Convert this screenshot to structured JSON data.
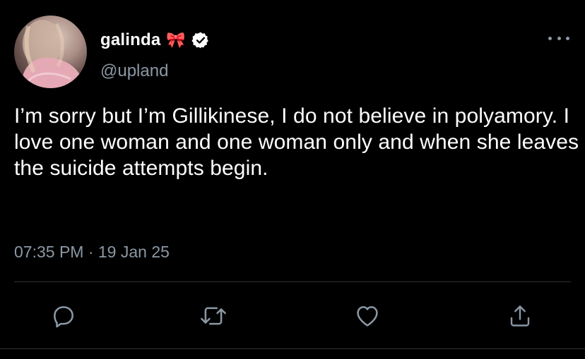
{
  "tweet": {
    "display_name": "galinda",
    "name_emoji": "🎀",
    "handle": "@upland",
    "verified": true,
    "text": "I’m sorry but I’m Gillikinese, I do not believe in polyamory. I love one woman and one woman only and when she leaves the suicide attempts begin.",
    "timestamp": "07:35 PM · 19 Jan 25"
  },
  "icons": {
    "more": "more-horizontal-icon",
    "reply": "reply-icon",
    "retweet": "retweet-icon",
    "like": "like-icon",
    "share": "share-icon",
    "verified": "verified-badge-icon"
  },
  "colors": {
    "background": "#000000",
    "text_primary": "#ffffff",
    "text_secondary": "#8b98a5",
    "divider": "#2f3336"
  }
}
